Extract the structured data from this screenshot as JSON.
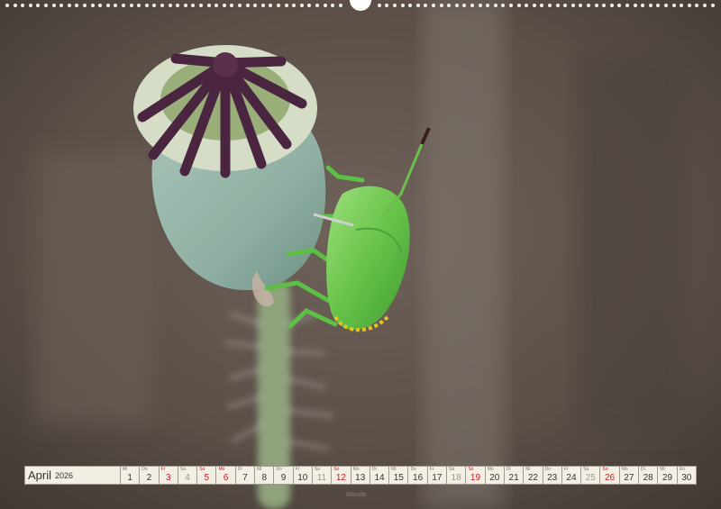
{
  "calendar": {
    "month": "April",
    "year": "2026",
    "days": [
      {
        "wd": "Mi",
        "d": "1",
        "type": "weekday"
      },
      {
        "wd": "Do",
        "d": "2",
        "type": "weekday"
      },
      {
        "wd": "Fr",
        "d": "3",
        "type": "sun"
      },
      {
        "wd": "Sa",
        "d": "4",
        "type": "sat"
      },
      {
        "wd": "So",
        "d": "5",
        "type": "sun"
      },
      {
        "wd": "Mo",
        "d": "6",
        "type": "sun"
      },
      {
        "wd": "Di",
        "d": "7",
        "type": "weekday"
      },
      {
        "wd": "Mi",
        "d": "8",
        "type": "weekday"
      },
      {
        "wd": "Do",
        "d": "9",
        "type": "weekday"
      },
      {
        "wd": "Fr",
        "d": "10",
        "type": "weekday"
      },
      {
        "wd": "Sa",
        "d": "11",
        "type": "sat"
      },
      {
        "wd": "So",
        "d": "12",
        "type": "sun"
      },
      {
        "wd": "Mo",
        "d": "13",
        "type": "weekday"
      },
      {
        "wd": "Di",
        "d": "14",
        "type": "weekday"
      },
      {
        "wd": "Mi",
        "d": "15",
        "type": "weekday"
      },
      {
        "wd": "Do",
        "d": "16",
        "type": "weekday"
      },
      {
        "wd": "Fr",
        "d": "17",
        "type": "weekday"
      },
      {
        "wd": "Sa",
        "d": "18",
        "type": "sat"
      },
      {
        "wd": "So",
        "d": "19",
        "type": "sun"
      },
      {
        "wd": "Mo",
        "d": "20",
        "type": "weekday"
      },
      {
        "wd": "Di",
        "d": "21",
        "type": "weekday"
      },
      {
        "wd": "Mi",
        "d": "22",
        "type": "weekday"
      },
      {
        "wd": "Do",
        "d": "23",
        "type": "weekday"
      },
      {
        "wd": "Fr",
        "d": "24",
        "type": "weekday"
      },
      {
        "wd": "Sa",
        "d": "25",
        "type": "sat"
      },
      {
        "wd": "So",
        "d": "26",
        "type": "sun"
      },
      {
        "wd": "Mo",
        "d": "27",
        "type": "weekday"
      },
      {
        "wd": "Di",
        "d": "28",
        "type": "weekday"
      },
      {
        "wd": "Mi",
        "d": "29",
        "type": "weekday"
      },
      {
        "wd": "Do",
        "d": "30",
        "type": "weekday"
      }
    ]
  },
  "credit": "Wanda",
  "colors": {
    "sunday_red": "#cc1a1a",
    "saturday_gray": "#9b9891",
    "calendar_bg": "#f3efe4",
    "bug_green": "#6cc24a",
    "poppy_capsule": "#9fb9ad",
    "poppy_crown": "#4a2540"
  },
  "icons": [
    "spiral-binding-icon",
    "hanger-hole-icon"
  ]
}
